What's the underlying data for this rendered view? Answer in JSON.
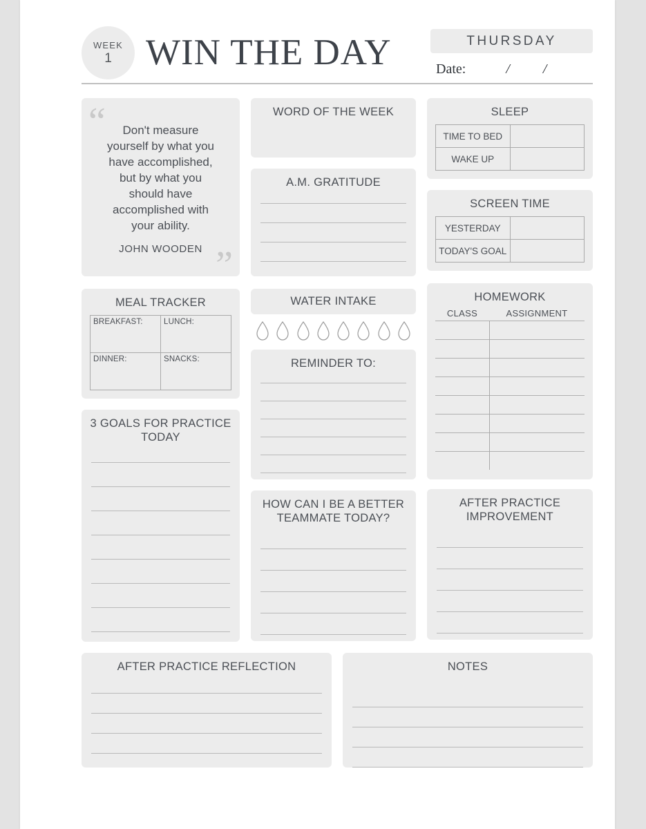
{
  "header": {
    "week_label": "WEEK",
    "week_number": "1",
    "title": "WIN THE DAY",
    "day": "THURSDAY",
    "date_label": "Date:",
    "date_sep_1": "/",
    "date_sep_2": "/"
  },
  "quote": {
    "text": "Don't measure yourself by what you have accomplished, but by what you should have accomplished with your ability.",
    "author": "JOHN WOODEN",
    "open_mark": "“",
    "close_mark": "”"
  },
  "sections": {
    "word_of_the_week": {
      "title": "WORD OF THE WEEK",
      "lines": 0
    },
    "am_gratitude": {
      "title": "A.M. GRATITUDE",
      "lines": 4
    },
    "sleep": {
      "title": "SLEEP",
      "rows": [
        {
          "key": "TIME TO BED",
          "value": ""
        },
        {
          "key": "WAKE UP",
          "value": ""
        }
      ]
    },
    "screen_time": {
      "title": "SCREEN TIME",
      "rows": [
        {
          "key": "YESTERDAY",
          "value": ""
        },
        {
          "key": "TODAY'S GOAL",
          "value": ""
        }
      ]
    },
    "meal_tracker": {
      "title": "MEAL TRACKER",
      "cells": [
        "BREAKFAST:",
        "LUNCH:",
        "DINNER:",
        "SNACKS:"
      ]
    },
    "water_intake": {
      "title": "WATER INTAKE",
      "droplets": 8,
      "filled": 0
    },
    "reminder_to": {
      "title": "REMINDER TO:",
      "lines": 6
    },
    "homework": {
      "title": "HOMEWORK",
      "columns": [
        "CLASS",
        "ASSIGNMENT"
      ],
      "rows": 8
    },
    "goals": {
      "title": "3 GOALS FOR PRACTICE TODAY",
      "lines": 8
    },
    "better_teammate": {
      "title": "HOW CAN I BE A BETTER TEAMMATE TODAY?",
      "lines": 5
    },
    "after_practice_improvement": {
      "title": "AFTER PRACTICE IMPROVEMENT",
      "lines": 5
    },
    "after_practice_reflection": {
      "title": "AFTER PRACTICE REFLECTION",
      "lines": 4
    },
    "notes": {
      "title": "NOTES",
      "lines": 4
    }
  },
  "colors": {
    "page_background": "#ffffff",
    "outer_background": "#e3e3e3",
    "card_background": "#ececec",
    "text": "#4b4f55",
    "title_text": "#3d4249",
    "rule": "#b9b9b9",
    "table_border": "#a9a9a9"
  }
}
